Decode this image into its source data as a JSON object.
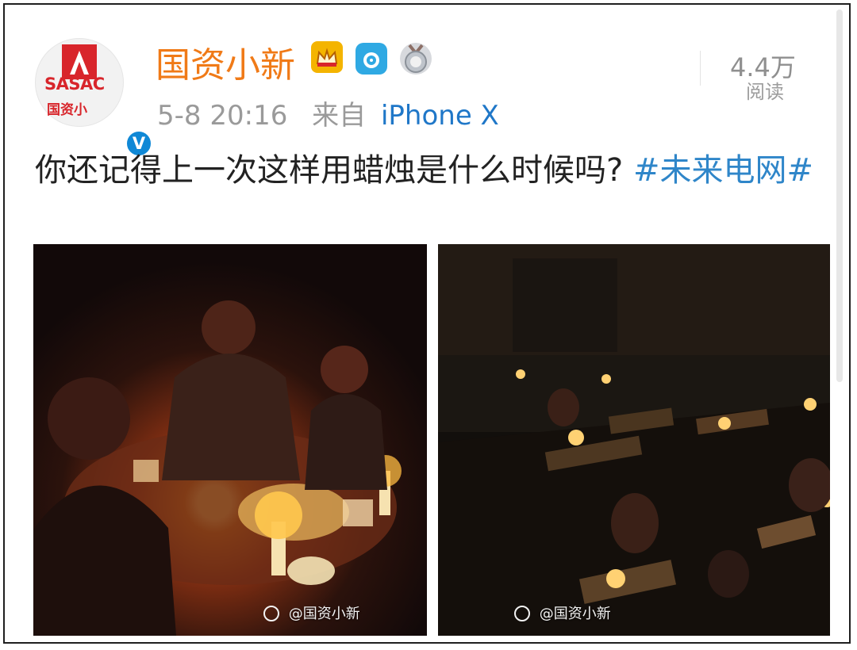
{
  "account": {
    "display_name": "国资小新",
    "avatar_logo_text": "SASAC",
    "avatar_cn_text": "国资小",
    "verified_mark": "V"
  },
  "post": {
    "date": "5-8",
    "time": "20:16",
    "source_prefix": "来自",
    "source": "iPhone X",
    "text": "你还记得上一次这样用蜡烛是什么时候吗?",
    "hashtag": "#未来电网#"
  },
  "stats": {
    "reads": "4.4万",
    "reads_label": "阅读"
  },
  "images": [
    {
      "watermark": "@国资小新"
    },
    {
      "watermark": "@国资小新"
    }
  ],
  "icons": {
    "verified": "verified-badge-icon",
    "vip": "crown-badge-icon",
    "camera": "camera-badge-icon",
    "medal": "medal-badge-icon"
  },
  "colors": {
    "name": "#f07a17",
    "link": "#1f77c8",
    "hashtag": "#2f86c9",
    "verified": "#0f88d6",
    "brand": "#d8252b"
  }
}
